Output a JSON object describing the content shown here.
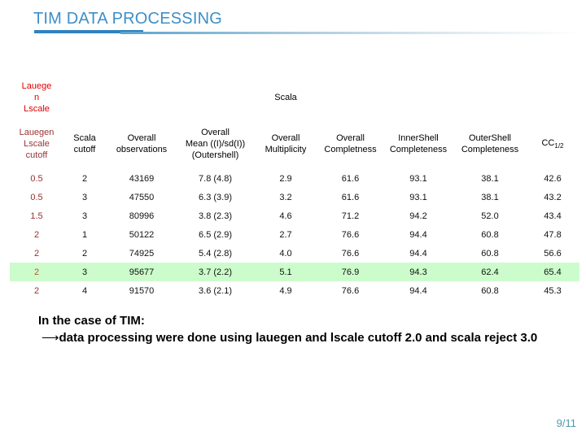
{
  "slide": {
    "title": "TIM DATA PROCESSING",
    "page_number": "9/11",
    "accent_color": "#3d8ec9",
    "highlight_color": "#ccffcc",
    "red_color": "#e00000"
  },
  "table": {
    "group_headers": [
      {
        "label": "Lauege\nn\nLscale",
        "line1": "Lauege",
        "line2": "n",
        "line3": "Lscale"
      },
      {
        "label": "Scala"
      }
    ],
    "columns": [
      {
        "id": "lauegen_lscale_cutoff",
        "line1": "Lauegen",
        "line2": "Lscale",
        "line3": "cutoff"
      },
      {
        "id": "scala_cutoff",
        "line1": "Scala",
        "line2": "cutoff",
        "line3": ""
      },
      {
        "id": "overall_observations",
        "line1": "Overall",
        "line2": "observations",
        "line3": ""
      },
      {
        "id": "overall_mean",
        "line1": "Overall",
        "line2": "Mean ((I)/sd(I))",
        "line3": "(Outershell)"
      },
      {
        "id": "overall_multiplicity",
        "line1": "Overall",
        "line2": "Multiplicity",
        "line3": ""
      },
      {
        "id": "overall_completness",
        "line1": "Overall",
        "line2": "Completness",
        "line3": ""
      },
      {
        "id": "innershell_completeness",
        "line1": "InnerShell",
        "line2": "Completeness",
        "line3": ""
      },
      {
        "id": "outershell_completeness",
        "line1": "OuterShell",
        "line2": "Completeness",
        "line3": ""
      },
      {
        "id": "cc_half",
        "line1": "CC",
        "line2": "1/2",
        "line3": ""
      }
    ],
    "rows": [
      {
        "highlight": false,
        "cells": [
          "0.5",
          "2",
          "43169",
          "7.8 (4.8)",
          "2.9",
          "61.6",
          "93.1",
          "38.1",
          "42.6"
        ]
      },
      {
        "highlight": false,
        "cells": [
          "0.5",
          "3",
          "47550",
          "6.3 (3.9)",
          "3.2",
          "61.6",
          "93.1",
          "38.1",
          "43.2"
        ]
      },
      {
        "highlight": false,
        "cells": [
          "1.5",
          "3",
          "80996",
          "3.8 (2.3)",
          "4.6",
          "71.2",
          "94.2",
          "52.0",
          "43.4"
        ]
      },
      {
        "highlight": false,
        "cells": [
          "2",
          "1",
          "50122",
          "6.5 (2.9)",
          "2.7",
          "76.6",
          "94.4",
          "60.8",
          "47.8"
        ]
      },
      {
        "highlight": false,
        "cells": [
          "2",
          "2",
          "74925",
          "5.4 (2.8)",
          "4.0",
          "76.6",
          "94.4",
          "60.8",
          "56.6"
        ]
      },
      {
        "highlight": true,
        "cells": [
          "2",
          "3",
          "95677",
          "3.7 (2.2)",
          "5.1",
          "76.9",
          "94.3",
          "62.4",
          "65.4"
        ]
      },
      {
        "highlight": false,
        "cells": [
          "2",
          "4",
          "91570",
          "3.6 (2.1)",
          "4.9",
          "76.6",
          "94.4",
          "60.8",
          "45.3"
        ]
      }
    ]
  },
  "note": {
    "line1": "In the case of TIM:",
    "arrow": "⟶",
    "line2": "data processing were done using lauegen and lscale cutoff 2.0 and scala reject 3.0"
  }
}
